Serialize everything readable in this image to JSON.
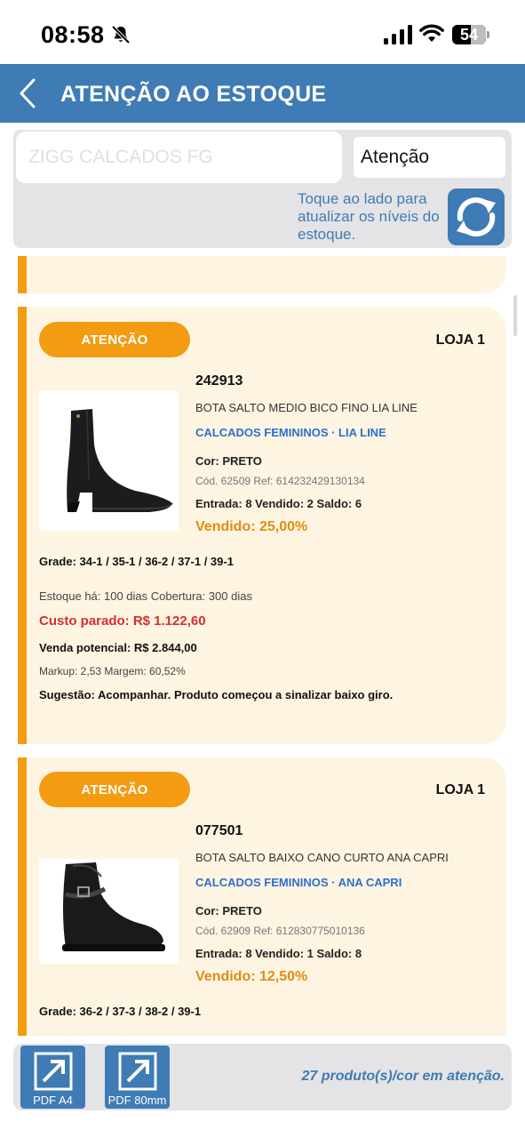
{
  "status_bar": {
    "time": "08:58",
    "battery": "54",
    "battery_level": 0.54
  },
  "header": {
    "title": "ATENÇÃO AO ESTOQUE"
  },
  "filters": {
    "store_placeholder": "ZIGG CALCADOS FG",
    "status_value": "Atenção",
    "refresh_hint": "Toque ao lado para atualizar os níveis do estoque."
  },
  "products": [
    {
      "badge": "ATENÇÃO",
      "store": "LOJA 1",
      "code": "242913",
      "description": "BOTA SALTO MEDIO BICO FINO LIA LINE",
      "categories": "CALCADOS FEMININOS · LIA LINE",
      "color": "Cor: PRETO",
      "refs": "Cód. 62509   Ref: 614232429130134",
      "moves": "Entrada: 8   Vendido: 2   Saldo: 6",
      "sold": "Vendido: 25,00%",
      "grade": "Grade: 34-1 / 35-1 / 36-2 / 37-1 / 39-1",
      "stock": "Estoque há: 100 dias     Cobertura: 300 dias",
      "cost": "Custo parado: R$ 1.122,60",
      "potential": "Venda potencial: R$ 2.844,00",
      "markup": "Markup: 2,53     Margem: 60,52%",
      "suggestion": "Sugestão: Acompanhar. Produto começou a sinalizar baixo giro.",
      "image_icon": "ankle-boot-high-heel-icon"
    },
    {
      "badge": "ATENÇÃO",
      "store": "LOJA 1",
      "code": "077501",
      "description": "BOTA SALTO BAIXO CANO CURTO ANA CAPRI",
      "categories": "CALCADOS FEMININOS · ANA CAPRI",
      "color": "Cor: PRETO",
      "refs": "Cód. 62909   Ref: 612830775010136",
      "moves": "Entrada: 8   Vendido: 1   Saldo: 8",
      "sold": "Vendido: 12,50%",
      "grade": "Grade: 36-2 / 37-3 / 38-2 / 39-1",
      "image_icon": "ankle-boot-flat-buckle-icon"
    }
  ],
  "footer": {
    "pdf_a4_label": "PDF A4",
    "pdf_80_label": "PDF 80mm",
    "summary": "27 produto(s)/cor em atenção."
  },
  "colors": {
    "primary": "#3f7bb5",
    "accent": "#f39c12",
    "card_bg": "#fdf5e2",
    "danger": "#d32f2f",
    "link": "#2e6fcf"
  }
}
